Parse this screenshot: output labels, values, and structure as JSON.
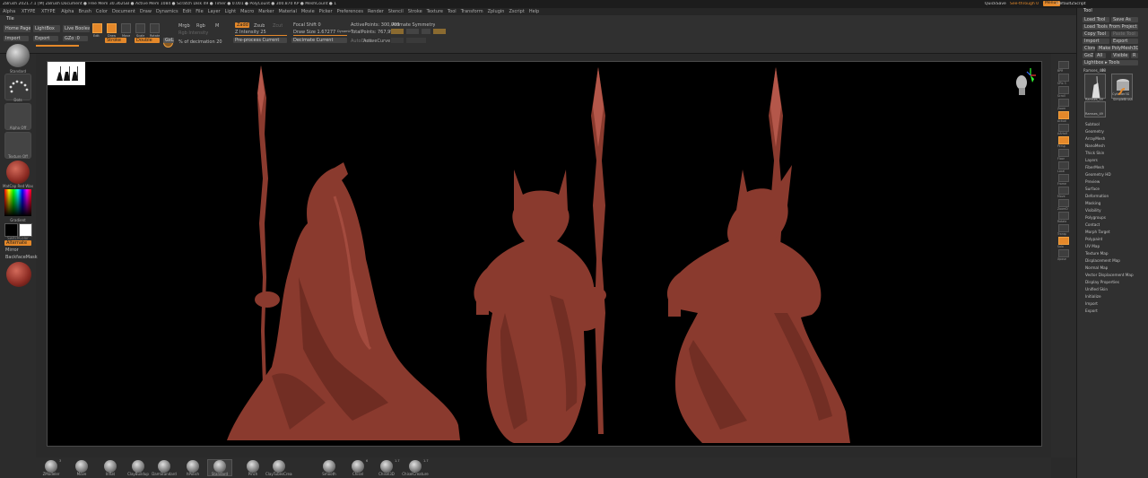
{
  "titlebar": {
    "title": "ZBrush 2021.7.1 [M]   ZBrush Document      ● Free Mem 30.362GB ● Active Mem 1084 ● Scratch Disk 49 ● Timer ● 0.001 ● PolyCount ● 300.870 KP ● MeshCount ● 1",
    "quicksave": "QuickSave",
    "seethrough": "See-through  0",
    "menus_label": "Menus",
    "script": "DefaultZScript"
  },
  "menubar": {
    "items": [
      "Alpha",
      "Brush",
      "Color",
      "Document",
      "Draw",
      "Dynamics",
      "Edit",
      "File",
      "Layer",
      "Light",
      "Macro",
      "Marker",
      "Material",
      "Movie",
      "Picker",
      "Preferences",
      "Render",
      "Stencil",
      "Stroke",
      "Texture",
      "Tool",
      "Transform",
      "Zplugin",
      "Zscript",
      "Help"
    ],
    "prefix": [
      "Alpha",
      "XTYPE",
      "XTYPE"
    ]
  },
  "shelf": {
    "tile": "Tile",
    "home_page": "Home Page",
    "lightbox": "LightBox",
    "live_boolean": "Live Boolean",
    "import": "Import",
    "export": "Export",
    "gz": "GZo :0",
    "edit": "Edit",
    "draw": "Draw",
    "move": "Move",
    "scale": "Scale",
    "rotate": "Rotate",
    "mrgb": "Mrgb",
    "rgb": "Rgb",
    "m": "M",
    "zadd": "Zadd",
    "zsub": "Zsub",
    "zcut": "Zcut",
    "focal_shift": "Focal Shift  0",
    "draw_size": "Draw Size  1.67277",
    "dynamic": "Dynamic",
    "active_points": "ActivePoints: 300,008",
    "total_points": "TotalPoints: 767,998",
    "animate_symmetry": "Animate Symmetry",
    "rgb_intensity": "Rgb Intensity",
    "z_intensity": "Z Intensity 25",
    "pre_process": "Pre-process Current",
    "decimate": "Decimate Current",
    "pct_decimation": "% of decimation  20",
    "dyn_btn": "Dyn",
    "stroke": "Stroke",
    "double": "Double",
    "gxl": "GxL",
    "autodraw": "AutoDraw",
    "activecurve": "ActiveCurve"
  },
  "left": {
    "standard": "Standard",
    "dots": "Dots",
    "alpha": "Alpha Off",
    "texture": "Texture Off",
    "material": "MatCap Red Wax",
    "gradient": "Gradient",
    "switch_color": "SwitchColor",
    "alternate": "Alternate",
    "mirror": "Mirror",
    "backface": "BackfaceMask"
  },
  "right_shelf": [
    "BPR",
    "SPix 3",
    "Scroll",
    "Zoom",
    "Actual",
    "AAHalf",
    "Persp",
    "Floor",
    "Local",
    "Frame",
    "Move",
    "ZoomD",
    "Rotate",
    "Transp",
    "Solo",
    "Xpose"
  ],
  "tray": {
    "title": "Tool",
    "buttons": [
      [
        "Load Tool",
        "Save As"
      ],
      [
        "Load Tools From Project"
      ],
      [
        "Copy Tool",
        "Paste Tool"
      ],
      [
        "Import",
        "Export"
      ],
      [
        "Clone",
        "Make PolyMesh3D"
      ],
      [
        "GoZ",
        "All",
        "Visible",
        "R"
      ]
    ],
    "lightbox_tools": "Lightbox ▸ Tools",
    "model_name": "Ramses_49",
    "model_count": "48",
    "thumb1": "Ramses_49",
    "thumb2": "Cylinder3D",
    "thumb3": "SimpleBrush",
    "thumb4": "Ramses_49",
    "subpalettes": [
      "Subtool",
      "Geometry",
      "ArrayMesh",
      "NanoMesh",
      "Thick Skin",
      "Layers",
      "FiberMesh",
      "Geometry HD",
      "Preview",
      "Surface",
      "Deformation",
      "Masking",
      "Visibility",
      "Polygroups",
      "Contact",
      "Morph Target",
      "Polypaint",
      "UV Map",
      "Texture Map",
      "Displacement Map",
      "Normal Map",
      "Vector Displacement Map",
      "Display Properties",
      "Unified Skin",
      "Initialize",
      "Import",
      "Export"
    ]
  },
  "bottom": {
    "brushes": [
      "ZModeler",
      "Move",
      "Inflat",
      "ClayBuildup",
      "DamStandard",
      "hPolish",
      "Standard",
      "Pinch",
      "ClayTubesCrease",
      "Smooth",
      "Chisel",
      "Chisel3D",
      "ChiselCreature"
    ],
    "counts": [
      "3",
      "",
      "",
      "",
      "",
      "",
      "",
      "",
      "",
      "",
      "6",
      "1.7",
      "1.7"
    ]
  },
  "colors": {
    "accent": "#e4882a",
    "model": "#8a3a2e",
    "viewport": "#000000"
  }
}
